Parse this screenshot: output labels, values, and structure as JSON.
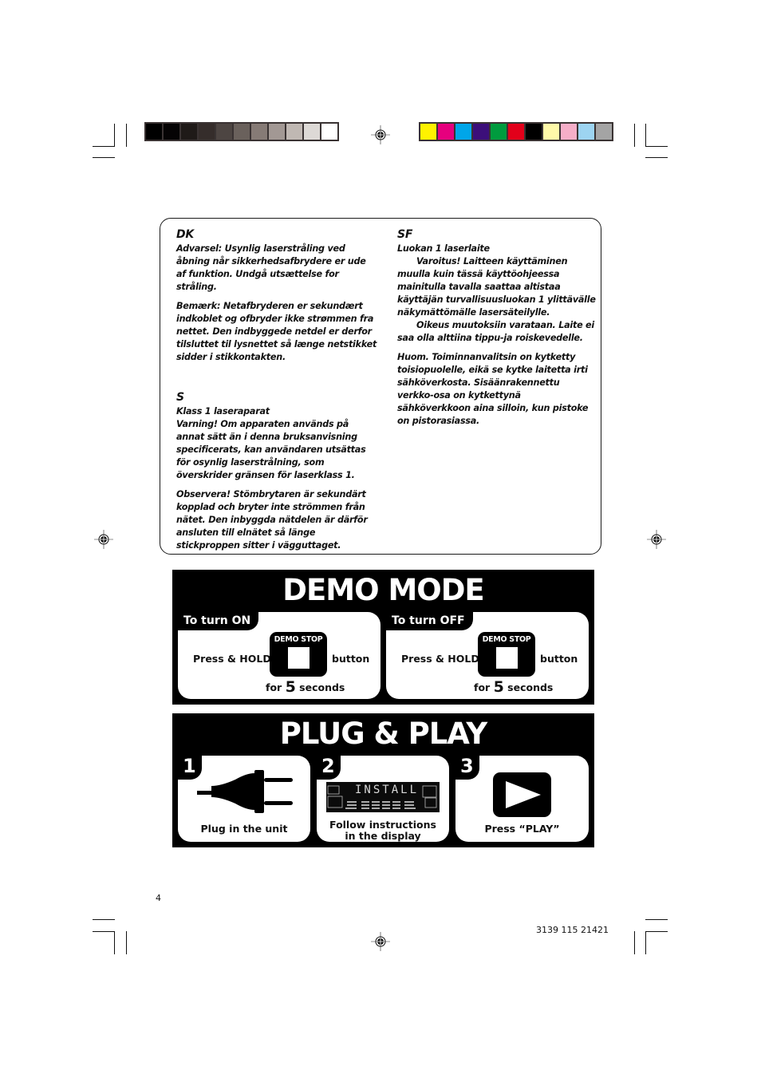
{
  "color_bars": {
    "grayscale": [
      "#000000",
      "#050304",
      "#1f1a18",
      "#352d2b",
      "#4d4542",
      "#6a615c",
      "#867b76",
      "#a29894",
      "#c0b8b3",
      "#ddd9d6",
      "#ffffff"
    ],
    "process": [
      "#fff200",
      "#e6007e",
      "#00a6e9",
      "#3c0f7a",
      "#009b3e",
      "#e2001a",
      "#000000",
      "#fff9a9",
      "#f5aec8",
      "#9dd4f1",
      "#a4a4a4"
    ]
  },
  "warnings": {
    "dk": {
      "heading": "DK",
      "para1": "Advarsel: Usynlig laserstråling ved åbning når sikkerhedsafbrydere er ude af funktion. Undgå utsættelse for stråling.",
      "para2": "Bemærk: Netafbryderen er sekundært indkoblet og ofbryder ikke strømmen fra nettet.  Den indbyggede netdel er derfor tilsluttet til lysnettet så længe netstikket sidder i stikkontakten."
    },
    "s": {
      "heading": "S",
      "line1": "Klass 1 laseraparat",
      "para1": "Varning! Om apparaten används på annat sätt än i denna bruksanvisning specificerats, kan användaren utsättas för osynlig laserstrålning, som överskrider gränsen för laserklass 1.",
      "para2": "Observera! Stömbrytaren är sekundärt kopplad och bryter inte strömmen från nätet.  Den inbyggda nätdelen är därför ansluten till elnätet så länge stickproppen sitter i vägguttaget."
    },
    "sf": {
      "heading": "SF",
      "line1": "Luokan 1 laserlaite",
      "para1": "Varoitus! Laitteen käyttäminen muulla kuin tässä käyttöohjeessa mainitulla tavalla saattaa altistaa käyttäjän turvallisuusluokan 1 ylittävälle näkymättömälle lasersäteilylle.",
      "para2": "Oikeus muutoksiin varataan.  Laite ei saa olla alttiina tippu-ja roiskevedelle.",
      "para3": "Huom. Toiminnanvalitsin on kytketty toisiopuolelle, eikä se kytke laitetta irti sähköverkosta.  Sisäänrakennettu verkko-osa on kytkettynä sähköverkkoon aina silloin, kun pistoke on pistorasiassa."
    }
  },
  "demo_mode": {
    "title": "DEMO MODE",
    "on": {
      "tab": "To turn ON",
      "press": "Press & HOLD",
      "button_label": "DEMO STOP",
      "suffix": "button",
      "for": "for",
      "seconds_value": "5",
      "seconds": "seconds"
    },
    "off": {
      "tab": "To turn OFF",
      "press": "Press & HOLD",
      "button_label": "DEMO STOP",
      "suffix": "button",
      "for": "for",
      "seconds_value": "5",
      "seconds": "seconds"
    }
  },
  "plug_play": {
    "title": "PLUG & PLAY",
    "steps": [
      {
        "num": "1",
        "caption": "Plug in the unit",
        "icon": "plug-icon"
      },
      {
        "num": "2",
        "caption_line1": "Follow instructions",
        "caption_line2": "in the display",
        "display_text": "INSTALL",
        "icon": "lcd-display-icon"
      },
      {
        "num": "3",
        "caption": "Press “PLAY”",
        "icon": "play-icon"
      }
    ]
  },
  "footer": {
    "page_number": "4",
    "doc_code": "3139 115 21421"
  }
}
